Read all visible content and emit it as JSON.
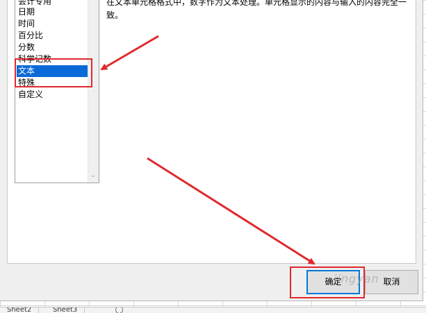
{
  "categories": {
    "items": [
      "会计专用",
      "日期",
      "时间",
      "百分比",
      "分数",
      "科学记数",
      "文本",
      "特殊",
      "自定义"
    ],
    "selected_index": 6
  },
  "description": {
    "line1": "在文本单元格格式中，数字作为文本处理。单元格显示的内容与输入的内容完全一",
    "line2": "致。"
  },
  "buttons": {
    "ok_label": "确定",
    "cancel_label": "取消"
  },
  "sheet_tabs": [
    "Sheet2",
    "Sheet3"
  ],
  "watermark": "jingyan",
  "colors": {
    "selection": "#0a6ad8",
    "annotation_red": "#e0282e"
  }
}
